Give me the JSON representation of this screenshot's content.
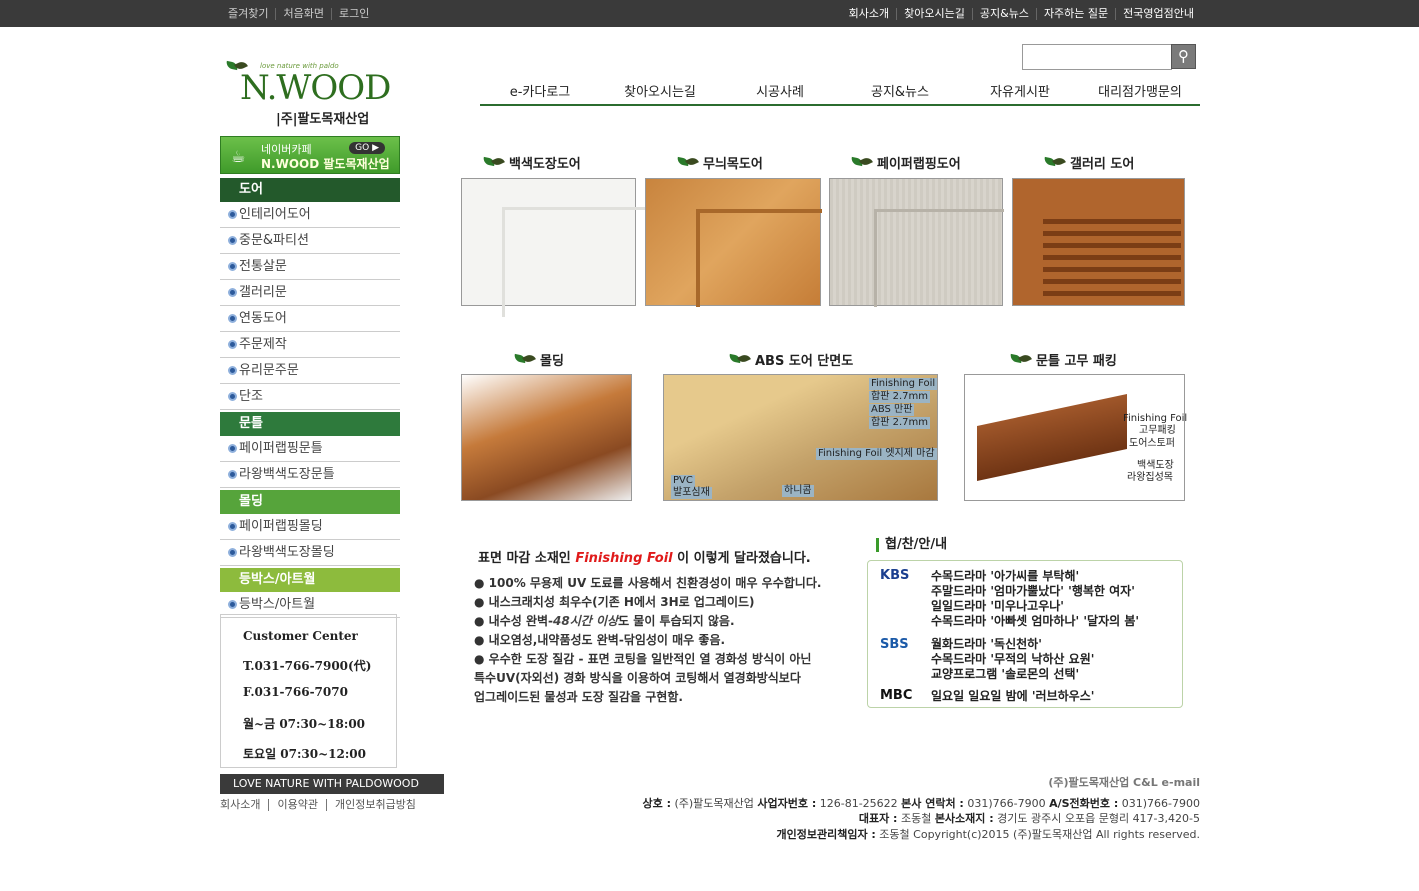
{
  "topbar": {
    "left": [
      "즐겨찾기",
      "처음화면",
      "로그인"
    ],
    "right": [
      "회사소개",
      "찾아오시는길",
      "공지&뉴스",
      "자주하는 질문",
      "전국영업점안내"
    ]
  },
  "logo": {
    "tagline": "love nature with paldo",
    "name": "N.WOOD",
    "corp": "|주|팔도목재산업"
  },
  "gnav": [
    "e-카다로그",
    "찾아오시는길",
    "시공사례",
    "공지&뉴스",
    "자유게시판",
    "대리점가맹문의"
  ],
  "cafe": {
    "line1": "네이버카페",
    "line2": "N.WOOD 팔도목재산업",
    "go": "GO ▶"
  },
  "lnav": {
    "door": {
      "title": "도어",
      "items": [
        "인테리어도어",
        "중문&파티션",
        "전통살문",
        "갤러리문",
        "연동도어",
        "주문제작",
        "유리문주문",
        "단조"
      ]
    },
    "frame": {
      "title": "문틀",
      "items": [
        "페이퍼랩핑문틀",
        "라왕백색도장문틀"
      ]
    },
    "molding": {
      "title": "몰딩",
      "items": [
        "페이퍼랩핑몰딩",
        "라왕백색도장몰딩"
      ]
    },
    "box": {
      "title": "등박스/아트월",
      "items": [
        "등박스/아트월"
      ]
    }
  },
  "cc": {
    "title": "Customer Center",
    "tel": "T.031-766-7900(代)",
    "fax": "F.031-766-7070",
    "weekday": "월~금 07:30~18:00",
    "sat": "토요일 07:30~12:00"
  },
  "love": "LOVE NATURE WITH PALDOWOOD",
  "flinks": [
    "회사소개",
    "이용약관",
    "개인정보취급방침"
  ],
  "products": {
    "p1": "백색도장도어",
    "p2": "무늬목도어",
    "p3": "페이퍼랩핑도어",
    "p4": "갤러리 도어",
    "p5": "몰딩",
    "p6": "ABS 도어 단면도",
    "p7": "문틀 고무 패킹"
  },
  "abs_labels": {
    "l1": "Finishing Foil",
    "l2": "합판 2.7mm",
    "l3": "ABS 만판",
    "l4": "합판 2.7mm",
    "l5": "Finishing Foil 엣지제 마감",
    "l6": "PVC",
    "l7": "발포심재",
    "l8": "하니콤"
  },
  "gasket_labels": {
    "l1": "Finishing Foil",
    "l2": "고무패킹",
    "l3": "도어스토퍼",
    "l4": "백색도장",
    "l5": "라왕집성목"
  },
  "ff": {
    "pre": "표면 마감 소재인",
    "em": "Finishing Foil",
    "post": "이 이렇게 달라졌습니다."
  },
  "bullets": {
    "b1": "● 100% 무용제 UV 도료를 사용해서 친환경성이 매우 우수합니다.",
    "b2": "● 내스크래치성 최우수(기존 H에서 3H로 업그레이드)",
    "b3a": "● 내수성 완벽-",
    "b3i": "48시간 이상",
    "b3b": "도 물이 투습되지 않음.",
    "b4": "● 내오염성,내약품성도 완벽-닦임성이 매우 좋음.",
    "b5": "● 우수한 도장 질감 - 표면 코팅을 일반적인 열 경화성 방식이 아닌",
    "b6": "특수UV(자외선) 경화 방식을 이용하여 코팅해서 열경화방식보다",
    "b7": "업그레이드된 물성과 도장 질감을 구현함."
  },
  "hj": {
    "title": "협/찬/안/내",
    "kbs": "KBS",
    "sbs": "SBS",
    "mbc": "MBC",
    "k1": "수목드라마 '아가씨를 부탁해'",
    "k2": "주말드라마 '엄마가뿔났다' '행복한 여자'",
    "k3": "일일드라마 '미우나고우나'",
    "k4": "수목드라마 '아빠셋 엄마하나' '달자의 봄'",
    "s1": "월화드라마 '독신천하'",
    "s2": "수목드라마 '무적의 낙하산 요원'",
    "s3": "교양프로그램 '솔로몬의 선택'",
    "m1": "일요일 일요일 밤에 '러브하우스'"
  },
  "footer": {
    "l1": "(주)팔도목재산업 C&L e-mail",
    "l2k1": "상호 :",
    "l2v1": " (주)팔도목재산업 ",
    "l2k2": "사업자번호 :",
    "l2v2": " 126-81-25622 ",
    "l2k3": "본사 연락처 :",
    "l2v3": " 031)766-7900 ",
    "l2k4": "A/S전화번호 :",
    "l2v4": " 031)766-7900",
    "l3k1": "대표자 :",
    "l3v1": " 조동철 ",
    "l3k2": "본사소재지 :",
    "l3v2": " 경기도 광주시 오포읍 문형리 417-3,420-5",
    "l4k1": "개인정보관리책임자 :",
    "l4v1": " 조동철 Copyright(c)2015 (주)팔도목재산업 All rights reserved."
  }
}
